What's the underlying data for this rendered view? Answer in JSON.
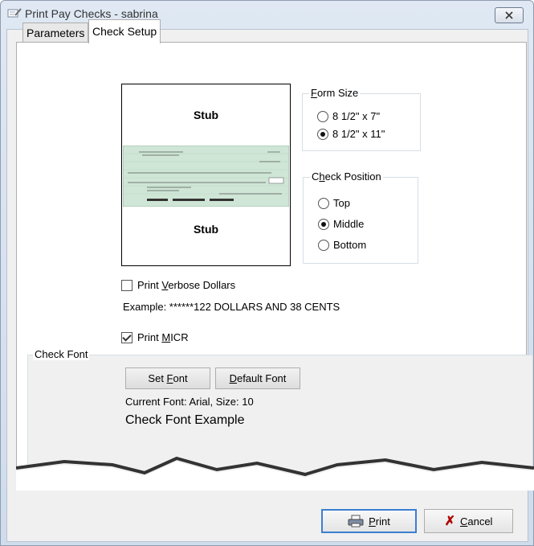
{
  "window": {
    "title": "Print Pay Checks - sabrina"
  },
  "tabs": [
    {
      "label": "Parameters"
    },
    {
      "label": "Check Setup"
    }
  ],
  "preview": {
    "top_stub": "Stub",
    "bottom_stub": "Stub"
  },
  "form_size": {
    "legend": "Form Size",
    "options": [
      {
        "label": "8 1/2\" x 7\"",
        "selected": false
      },
      {
        "label": "8 1/2\" x 11\"",
        "selected": true
      }
    ]
  },
  "check_position": {
    "legend": "Check Position",
    "options": [
      {
        "label": "Top",
        "selected": false
      },
      {
        "label": "Middle",
        "selected": true
      },
      {
        "label": "Bottom",
        "selected": false
      }
    ]
  },
  "verbose": {
    "label": "Print Verbose Dollars",
    "checked": false,
    "example": "Example: ******122 DOLLARS AND 38 CENTS"
  },
  "micr": {
    "label": "Print MICR",
    "checked": true
  },
  "check_font": {
    "legend": "Check Font",
    "set_font": "Set Font",
    "default_font": "Default Font",
    "current": "Current Font: Arial, Size: 10",
    "example": "Check Font Example"
  },
  "footer": {
    "print": "Print",
    "cancel": "Cancel"
  },
  "colors": {
    "accent": "#3b7fd1",
    "check_green": "#cfe6d6",
    "cancel_red": "#b00000"
  }
}
